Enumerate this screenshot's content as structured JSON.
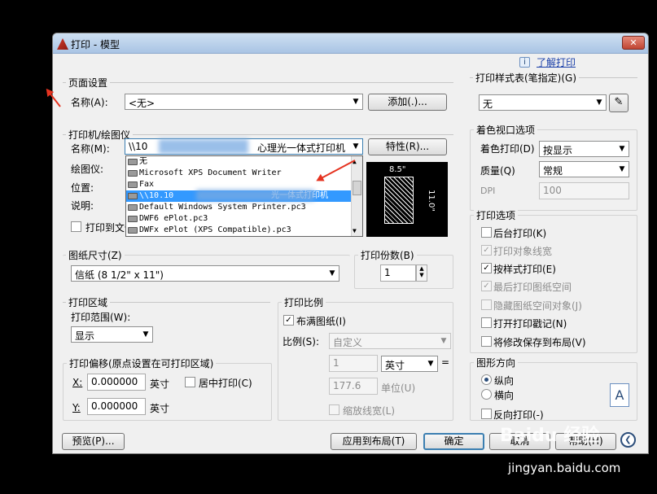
{
  "title": "打印 - 模型",
  "help_link": "了解打印",
  "page_setup": {
    "label": "页面设置",
    "name_label": "名称(A):",
    "name_value": "<无>",
    "add_button": "添加(.)..."
  },
  "plotter": {
    "label": "打印机/绘图仪",
    "name_label": "名称(M):",
    "name_value_prefix": "\\\\10",
    "name_value_suffix": "心理光一体式打印机",
    "properties_button": "特性(R)...",
    "plotter_label": "绘图仪:",
    "location_label": "位置:",
    "description_label": "说明:",
    "print_to_file": "打印到文件",
    "dropdown_items": [
      "无",
      "Microsoft XPS Document Writer",
      "Fax",
      "\\\\10.10",
      "光一体式打印机",
      "Default Windows System Printer.pc3",
      "DWF6 ePlot.pc3",
      "DWFx ePlot (XPS Compatible).pc3"
    ],
    "paper_width": "8.5\"",
    "paper_height": "11.0\""
  },
  "paper_size": {
    "label": "图纸尺寸(Z)",
    "value": "信纸 (8 1/2\" x 11\")"
  },
  "copies": {
    "label": "打印份数(B)",
    "value": "1"
  },
  "plot_area": {
    "label": "打印区域",
    "range_label": "打印范围(W):",
    "range_value": "显示"
  },
  "plot_offset": {
    "label": "打印偏移(原点设置在可打印区域)",
    "x_label": "X:",
    "x_value": "0.000000",
    "y_label": "Y:",
    "y_value": "0.000000",
    "unit": "英寸",
    "center_label": "居中打印(C)"
  },
  "plot_scale": {
    "label": "打印比例",
    "fit_label": "布满图纸(I)",
    "scale_label": "比例(S):",
    "scale_value": "自定义",
    "value1": "1",
    "unit_value": "英寸",
    "value2": "177.6",
    "unit_label": "单位(U)",
    "lineweights_label": "缩放线宽(L)",
    "equals": "="
  },
  "style_table": {
    "label": "打印样式表(笔指定)(G)",
    "value": "无"
  },
  "shaded_viewport": {
    "label": "着色视口选项",
    "shade_label": "着色打印(D)",
    "shade_value": "按显示",
    "quality_label": "质量(Q)",
    "quality_value": "常规",
    "dpi_label": "DPI",
    "dpi_value": "100"
  },
  "plot_options": {
    "label": "打印选项",
    "items": [
      {
        "label": "后台打印(K)",
        "checked": false,
        "disabled": false
      },
      {
        "label": "打印对象线宽",
        "checked": true,
        "disabled": true
      },
      {
        "label": "按样式打印(E)",
        "checked": true,
        "disabled": false
      },
      {
        "label": "最后打印图纸空间",
        "checked": true,
        "disabled": true
      },
      {
        "label": "隐藏图纸空间对象(J)",
        "checked": false,
        "disabled": true
      },
      {
        "label": "打开打印戳记(N)",
        "checked": false,
        "disabled": false
      },
      {
        "label": "将修改保存到布局(V)",
        "checked": false,
        "disabled": false
      }
    ]
  },
  "orientation": {
    "label": "图形方向",
    "portrait": "纵向",
    "landscape": "横向",
    "reverse": "反向打印(-)"
  },
  "buttons": {
    "preview": "预览(P)...",
    "apply": "应用到布局(T)",
    "ok": "确定",
    "cancel": "取消",
    "help": "帮助(H)"
  },
  "watermark": {
    "brand": "Baidu 经验",
    "url": "jingyan.baidu.com"
  },
  "colors": {
    "selection": "#3399ff",
    "annotation": "#e53320",
    "title_bar": "#a9c4e4"
  }
}
